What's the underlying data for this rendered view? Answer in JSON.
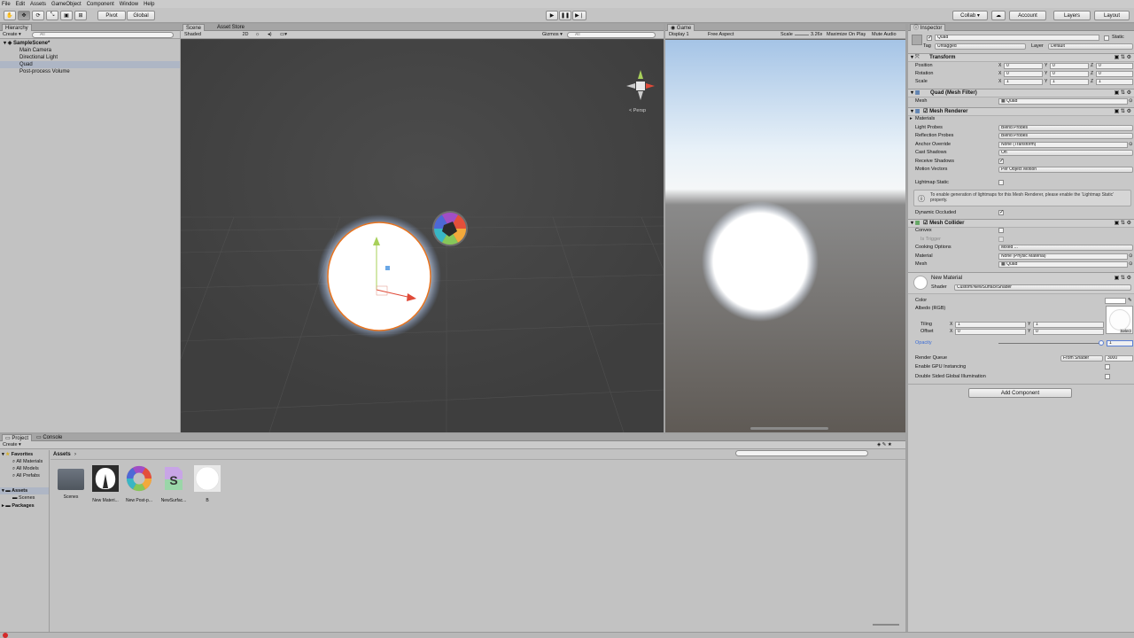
{
  "menu": [
    "File",
    "Edit",
    "Assets",
    "GameObject",
    "Component",
    "Window",
    "Help"
  ],
  "toolbar": {
    "pivot": "Pivot",
    "global": "Global",
    "collab": "Collab ▾",
    "account": "Account",
    "layers": "Layers",
    "layout": "Layout"
  },
  "hierarchy": {
    "tab": "Hierarchy",
    "create": "Create ▾",
    "search": "All",
    "scene": "SampleScene*",
    "items": [
      "Main Camera",
      "Directional Light",
      "Quad",
      "Post-process Volume"
    ]
  },
  "scene": {
    "tabs": [
      "Scene",
      "Asset Store"
    ],
    "shading": "Shaded",
    "mode2d": "2D",
    "gizmos": "Gizmos ▾",
    "search": "All",
    "persp": "< Persp"
  },
  "game": {
    "tab": "Game",
    "display": "Display 1",
    "aspect": "Free Aspect",
    "scale_label": "Scale",
    "scale_value": "3.26x",
    "maximize": "Maximize On Play",
    "mute": "Mute Audio"
  },
  "inspector": {
    "tab": "Inspector",
    "object_name": "Quad",
    "static": "Static",
    "tag_label": "Tag",
    "tag": "Untagged",
    "layer_label": "Layer",
    "layer": "Default",
    "transform": {
      "title": "Transform",
      "rows": [
        {
          "label": "Position",
          "x": "0",
          "y": "0",
          "z": "0"
        },
        {
          "label": "Rotation",
          "x": "0",
          "y": "0",
          "z": "0"
        },
        {
          "label": "Scale",
          "x": "1",
          "y": "1",
          "z": "1"
        }
      ]
    },
    "mesh_filter": {
      "title": "Quad (Mesh Filter)",
      "mesh_label": "Mesh",
      "mesh": "Quad"
    },
    "mesh_renderer": {
      "title": "Mesh Renderer",
      "materials": "Materials",
      "rows": [
        {
          "label": "Light Probes",
          "value": "Blend Probes"
        },
        {
          "label": "Reflection Probes",
          "value": "Blend Probes"
        },
        {
          "label": "Anchor Override",
          "value": "None (Transform)"
        },
        {
          "label": "Cast Shadows",
          "value": "On"
        },
        {
          "label": "Receive Shadows",
          "value": "✓"
        },
        {
          "label": "Motion Vectors",
          "value": "Per Object Motion"
        }
      ],
      "lightmap_static": "Lightmap Static",
      "info": "To enable generation of lightmaps for this Mesh Renderer, please enable the 'Lightmap Static' property.",
      "dynamic_occluded": "Dynamic Occluded"
    },
    "mesh_collider": {
      "title": "Mesh Collider",
      "convex": "Convex",
      "is_trigger": "Is Trigger",
      "cooking_label": "Cooking Options",
      "cooking": "Mixed ...",
      "material_label": "Material",
      "material": "None (Physic Material)",
      "mesh_label": "Mesh",
      "mesh": "Quad"
    },
    "material": {
      "title": "New Material",
      "shader_label": "Shader",
      "shader": "Custom/NewSurfaceShader",
      "color": "Color",
      "albedo": "Albedo (RGB)",
      "tiling": "Tiling",
      "offset": "Offset",
      "tiling_x": "1",
      "tiling_y": "1",
      "offset_x": "0",
      "offset_y": "0",
      "select": "Select",
      "opacity": "Opacity",
      "opacity_value": "1",
      "render_queue": "Render Queue",
      "render_queue_mode": "From Shader",
      "render_queue_value": "3000",
      "gpu_instancing": "Enable GPU Instancing",
      "double_sided": "Double Sided Global Illumination"
    },
    "add_component": "Add Component"
  },
  "project": {
    "tabs": [
      "Project",
      "Console"
    ],
    "create": "Create ▾",
    "favorites": "Favorites",
    "fav_items": [
      "All Materials",
      "All Models",
      "All Prefabs"
    ],
    "assets": "Assets",
    "asset_children": [
      "Scenes"
    ],
    "packages": "Packages",
    "breadcrumb": "Assets",
    "files": [
      "Scenes",
      "New Materi...",
      "New Post-p...",
      "NewSurfac...",
      "B"
    ]
  },
  "colors": {
    "accent_selection": "#aeb6c5",
    "scene_bg": "#474747",
    "outline": "#e8731e"
  }
}
